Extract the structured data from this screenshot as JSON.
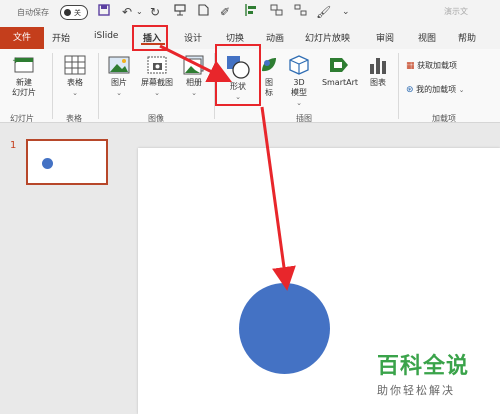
{
  "qat": {
    "autosave_label": "自动保存",
    "autosave_state": "关",
    "title_right": "演示文"
  },
  "tabs": [
    "文件",
    "开始",
    "iSlide",
    "插入",
    "设计",
    "切换",
    "动画",
    "幻灯片放映",
    "审阅",
    "视图",
    "帮助"
  ],
  "ribbon": {
    "new_slide": "新建\n幻灯片",
    "table": "表格",
    "picture": "图片",
    "screenshot": "屏幕截图",
    "album": "相册",
    "shapes": "形状",
    "icons": "图\n标",
    "model3d": "3D\n模型",
    "smartart": "SmartArt",
    "chart": "图表",
    "get_addins": "获取加载项",
    "my_addins": "我的加载项",
    "groups": {
      "slides": "幻灯片",
      "tables": "表格",
      "images": "图像",
      "illustrations": "插图",
      "addins": "加载项"
    }
  },
  "thumbnail": {
    "number": "1"
  },
  "watermark": {
    "title": "百科全说",
    "subtitle": "助你轻松解决"
  },
  "colors": {
    "accent": "#c43e1c",
    "shape_fill": "#4472c4",
    "highlight": "#e8262b",
    "watermark": "#3aa34a"
  }
}
